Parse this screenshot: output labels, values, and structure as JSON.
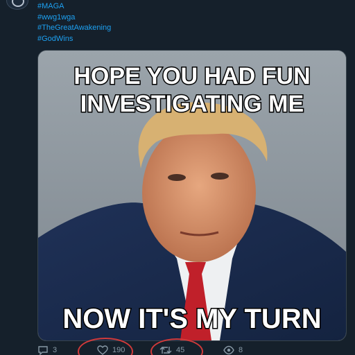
{
  "tweet": {
    "hashtags": [
      "#MAGA",
      "#wwg1wga",
      "#TheGreatAwakening",
      "#GodWins"
    ],
    "image": {
      "top_caption_line1": "HOPE YOU HAD FUN",
      "top_caption_line2": "INVESTIGATING ME",
      "bottom_caption": "NOW IT'S MY TURN"
    },
    "actions": {
      "reply_count": "3",
      "like_count": "190",
      "retweet_count": "45",
      "view_count": "8"
    }
  },
  "colors": {
    "background": "#15202b",
    "hashtag": "#1da1f2",
    "action_icon": "#8899a6",
    "annotation": "#d23a3a"
  }
}
